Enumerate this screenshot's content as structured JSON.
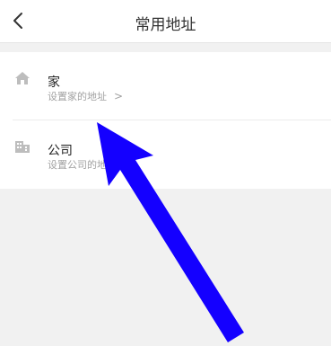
{
  "header": {
    "title": "常用地址",
    "back_icon": "chevron-left-icon"
  },
  "addresses": [
    {
      "title": "家",
      "subtitle": "设置家的地址",
      "icon": "house-icon",
      "chevron": ">"
    },
    {
      "title": "公司",
      "subtitle": "设置公司的地址",
      "icon": "building-icon",
      "chevron": ">"
    }
  ],
  "colors": {
    "background": "#f1f1f1",
    "card": "#ffffff",
    "annotation_arrow": "#1400ff"
  }
}
